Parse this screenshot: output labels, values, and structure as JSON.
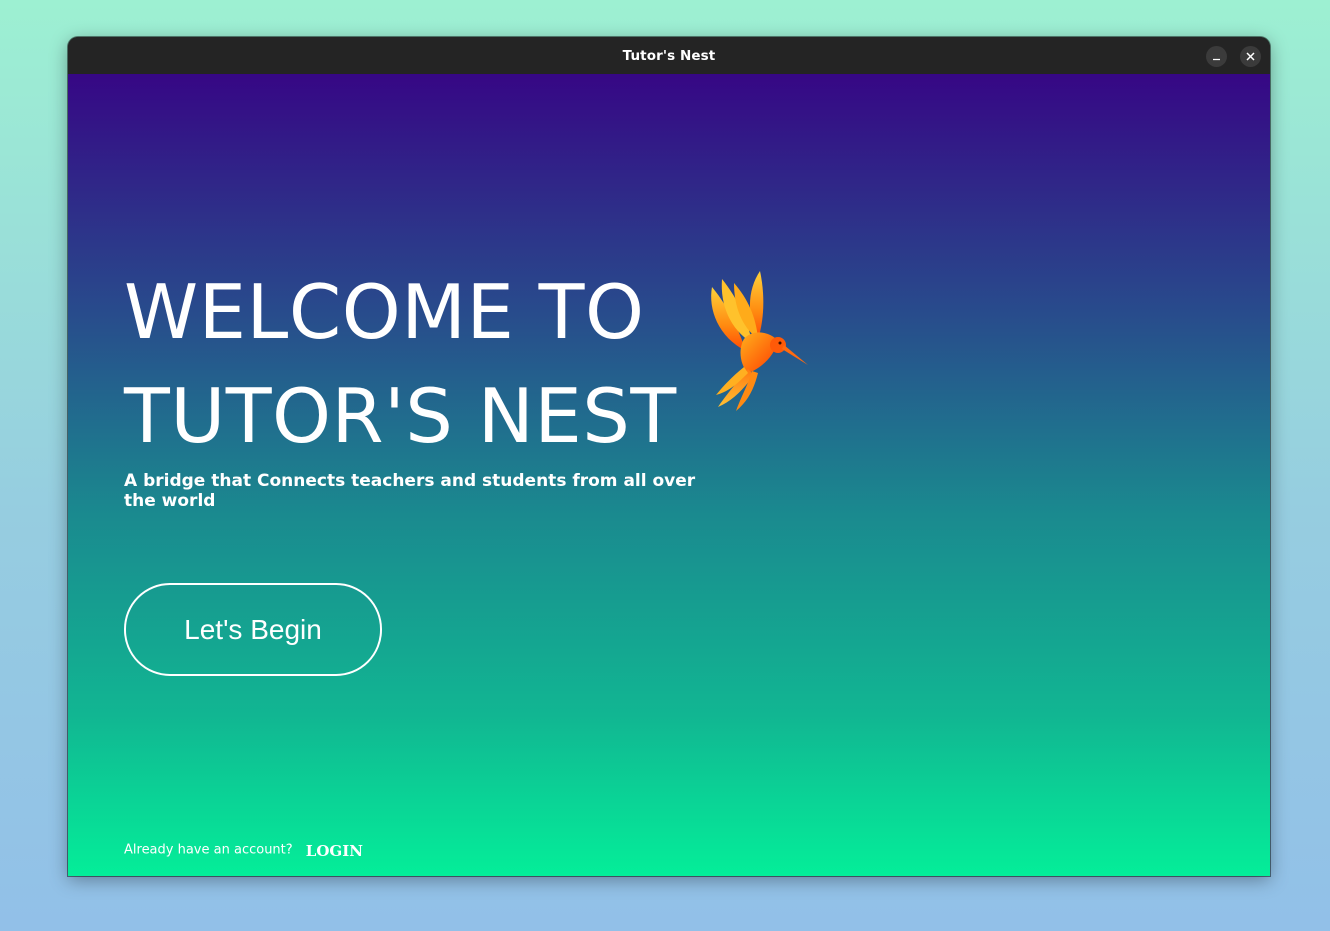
{
  "window": {
    "title": "Tutor's Nest"
  },
  "titlebar": {
    "minimize_icon": "minimize-icon",
    "close_icon": "close-icon"
  },
  "hero": {
    "heading_line1": "WELCOME TO",
    "heading_line2": "TUTOR'S NEST",
    "tagline": "A bridge that Connects teachers and students from all over the world",
    "logo": "hummingbird-logo"
  },
  "cta": {
    "begin_label": "Let's Begin"
  },
  "footer": {
    "prompt": "Already have an account?",
    "login_label": "LOGIN"
  },
  "colors": {
    "gradient_top": "#360785",
    "gradient_bottom": "#04ee99",
    "titlebar": "#242424",
    "text": "#ffffff"
  }
}
